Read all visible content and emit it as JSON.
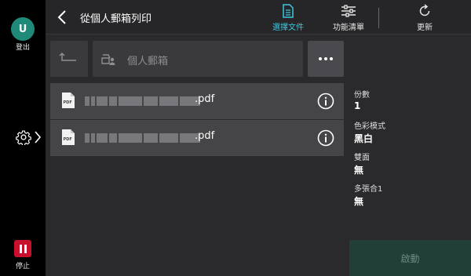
{
  "rail": {
    "user_initial": "U",
    "logout_label": "登出",
    "stop_label": "停止"
  },
  "header": {
    "title": "從個人郵箱列印",
    "tools": [
      {
        "label": "選擇文件",
        "icon": "document-icon",
        "active": true
      },
      {
        "label": "功能清單",
        "icon": "sliders-icon",
        "active": false
      },
      {
        "label": "更新",
        "icon": "refresh-icon",
        "active": false
      }
    ]
  },
  "path": {
    "label": "個人郵箱"
  },
  "files": [
    {
      "name_suffix": ".pdf",
      "type": "PDF"
    },
    {
      "name_suffix": ".pdf",
      "type": "PDF"
    }
  ],
  "settings": [
    {
      "label": "份數",
      "value": "1"
    },
    {
      "label": "色彩模式",
      "value": "黑白"
    },
    {
      "label": "雙面",
      "value": "無"
    },
    {
      "label": "多張合1",
      "value": "無"
    }
  ],
  "start_label": "啟動",
  "colors": {
    "accent": "#3cc8e0",
    "user": "#1f8a7a",
    "stop": "#c8102e",
    "start_disabled": "#213e37"
  }
}
